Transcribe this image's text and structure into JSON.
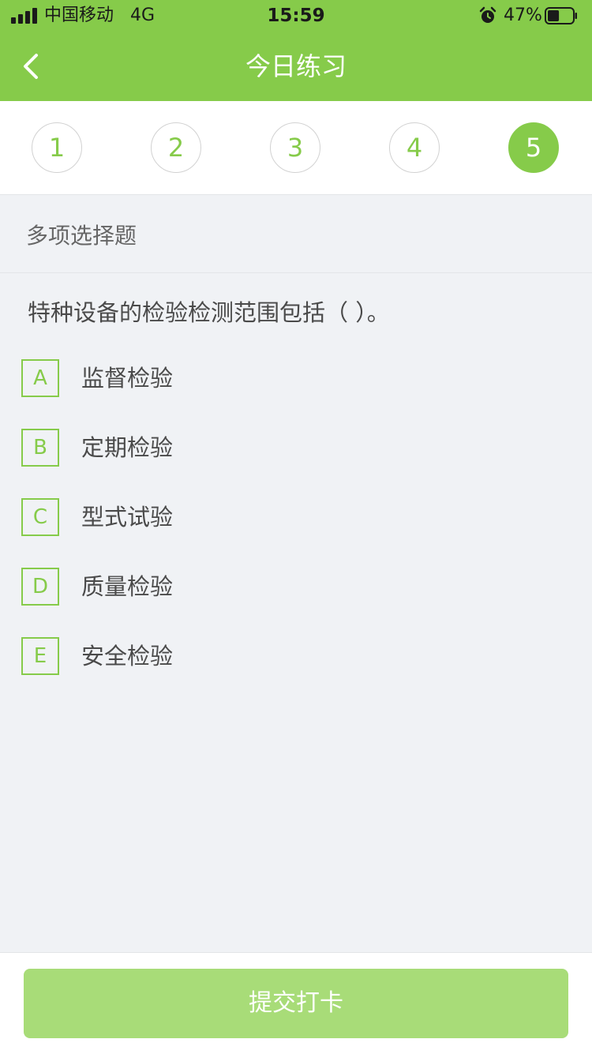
{
  "status_bar": {
    "carrier": "中国移动",
    "network": "4G",
    "time": "15:59",
    "battery_percent": "47%",
    "battery_level": 0.47,
    "icons": [
      "signal-icon",
      "alarm-icon",
      "battery-icon"
    ]
  },
  "nav": {
    "title": "今日练习",
    "back_icon": "chevron-left-icon"
  },
  "steps": {
    "items": [
      "1",
      "2",
      "3",
      "4",
      "5"
    ],
    "active": "5"
  },
  "section": {
    "title": "多项选择题"
  },
  "question": {
    "text": "特种设备的检验检测范围包括（    ）。",
    "options": [
      {
        "key": "A",
        "text": "监督检验"
      },
      {
        "key": "B",
        "text": "定期检验"
      },
      {
        "key": "C",
        "text": "型式试验"
      },
      {
        "key": "D",
        "text": "质量检验"
      },
      {
        "key": "E",
        "text": "安全检验"
      }
    ]
  },
  "footer": {
    "submit_label": "提交打卡"
  },
  "colors": {
    "primary": "#86cb4a",
    "submit_disabled": "#a8dc78",
    "background": "#f0f2f5",
    "text": "#4a4a4a"
  }
}
